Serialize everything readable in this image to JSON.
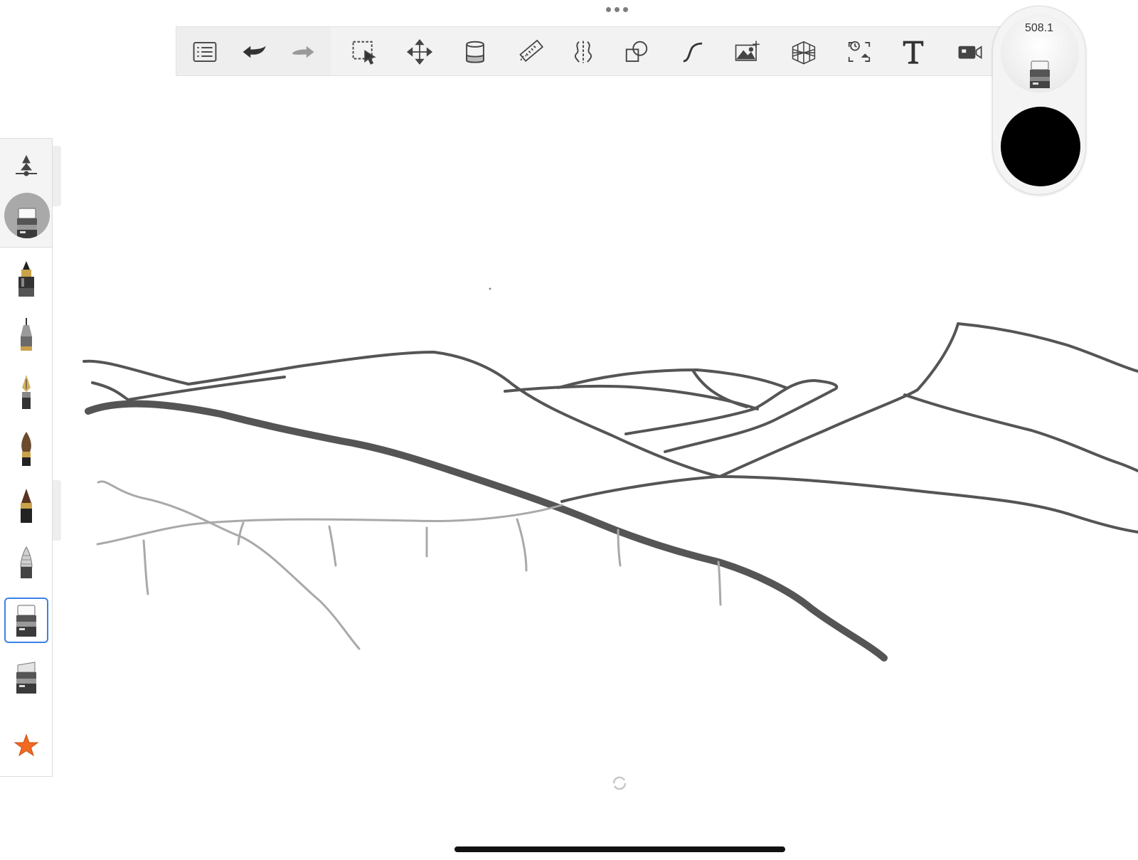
{
  "toolbar": {
    "items": [
      {
        "name": "gallery-list-icon"
      },
      {
        "name": "undo-icon"
      },
      {
        "name": "redo-icon"
      },
      {
        "name": "selection-icon"
      },
      {
        "name": "transform-icon"
      },
      {
        "name": "fill-bucket-icon"
      },
      {
        "name": "ruler-icon"
      },
      {
        "name": "symmetry-icon"
      },
      {
        "name": "shapes-icon"
      },
      {
        "name": "curve-icon"
      },
      {
        "name": "insert-image-icon"
      },
      {
        "name": "perspective-guide-icon"
      },
      {
        "name": "time-lapse-icon"
      },
      {
        "name": "text-icon"
      },
      {
        "name": "video-record-icon"
      }
    ]
  },
  "color_puck": {
    "brush_size": "508.1",
    "current_color": "#000000"
  },
  "brush_palette": {
    "current_brush": "eraser",
    "brushes": [
      "pencil",
      "technical-pen",
      "fountain-pen",
      "paint-brush",
      "marker",
      "airbrush",
      "eraser",
      "soft-eraser"
    ],
    "selected": "eraser",
    "favorites_icon": "star-icon",
    "accent_color": "#3c82e6",
    "star_color": "#f26a21"
  },
  "canvas": {
    "stroke_colors": {
      "dark": "#555555",
      "light": "#a9a9a9"
    }
  }
}
